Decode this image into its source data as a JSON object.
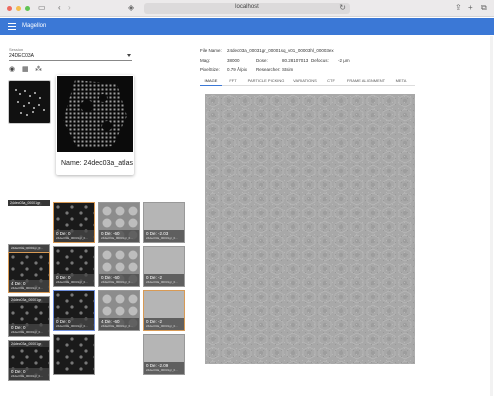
{
  "browser": {
    "url": "localhost",
    "icons": [
      "sidebar-icon",
      "back-icon",
      "forward-icon",
      "shield-icon",
      "reload-icon",
      "share-icon",
      "new-tab-icon",
      "tabs-icon"
    ]
  },
  "app": {
    "title": "Magellon",
    "accent": "#3b78d6"
  },
  "session": {
    "label": "Session",
    "value": "24DEC03A"
  },
  "atlas": {
    "name": "Name: 24dec03a_atlas"
  },
  "tiles": [
    {
      "header": "24dec03a_00001gr",
      "line1": "",
      "line2": "",
      "style": "dark"
    },
    {
      "header": "",
      "line1": "0 De: 0",
      "line2": "24dec03a_00031gr_0...",
      "style": "dark",
      "sel": "orange"
    },
    {
      "header": "",
      "line1": "0 De: -60",
      "line2": "24dec03a_00031gr_0...",
      "style": "gray"
    },
    {
      "header": "",
      "line1": "0 De: -2.03",
      "line2": "24dec03a_00031gr_0...",
      "style": "light"
    },
    {
      "header": "24dec03a_00001gr",
      "line1": "0 De: 0",
      "line2": "24dec03a_00001gr_0...",
      "style": "dark"
    },
    {
      "header": "",
      "line1": "4 De: 0",
      "line2": "24dec03a_00031gr_0...",
      "style": "dark",
      "sel": "orange"
    },
    {
      "header": "",
      "line1": "0 De: 0",
      "line2": "24dec03a_00031gr_0...",
      "style": "dark"
    },
    {
      "header": "",
      "line1": "0 De: -60",
      "line2": "24dec03a_00031gr_0...",
      "style": "gray"
    },
    {
      "header": "",
      "line1": "0 De: -2",
      "line2": "24dec03a_00031gr_0...",
      "style": "light"
    },
    {
      "header": "24dec03a_00001gr",
      "line1": "0 De: 0",
      "line2": "24dec03a_00001gr_0...",
      "style": "dark"
    },
    {
      "header": "",
      "line1": "0 De: 0",
      "line2": "24dec03a_00031gr_0...",
      "style": "dark",
      "sel": "blue"
    },
    {
      "header": "",
      "line1": "4 De: -60",
      "line2": "24dec03a_00031gr_0...",
      "style": "gray"
    },
    {
      "header": "",
      "line1": "0 De: -2",
      "line2": "24dec03a_00031gr_0...",
      "style": "light",
      "sel": "orange"
    },
    {
      "header": "24dec03a_00001gr",
      "line1": "0 De: 0",
      "line2": "24dec03a_00001gr_0...",
      "style": "dark"
    },
    {
      "header": "",
      "line1": "",
      "line2": "",
      "style": "dark"
    },
    {
      "header": "",
      "line1": "0 De: -2.09",
      "line2": "24dec03a_00031gr_0...",
      "style": "light"
    }
  ],
  "details": {
    "file_name_label": "File Name:",
    "file_name_value": "24dec03a_00031gr_00001sq_v01_00003hl_00003ex",
    "mag_label": "Mag:",
    "mag_value": "38000",
    "dose_label": "Dose:",
    "dose_value": "80.28107013",
    "defocus_label": "Defocus:",
    "defocus_value": "-2 μm",
    "pixelsize_label": "PixelSize:",
    "pixelsize_value": "0.79 Å/pix",
    "researcher_label": "Researcher:",
    "researcher_value": "Stsim"
  },
  "tabs": [
    "IMAGE",
    "FFT",
    "PARTICLE PICKING",
    "VARIATIONS",
    "CTF",
    "FRAME ALIGNMENT",
    "META"
  ],
  "active_tab": 0
}
